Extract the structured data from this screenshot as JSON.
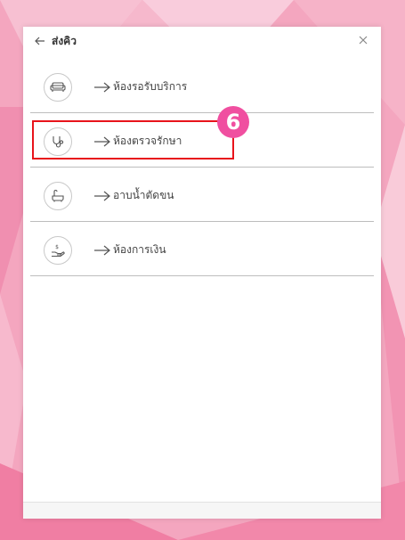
{
  "colors": {
    "background": "#f4a6bf",
    "highlight": "#e8141b",
    "badge": "#f04fa0"
  },
  "header": {
    "back_icon": "arrow-left-icon",
    "title": "ส่งคิว",
    "close_icon": "close-icon"
  },
  "list": {
    "items": [
      {
        "icon": "sofa-icon",
        "label": "ห้องรอรับบริการ"
      },
      {
        "icon": "stethoscope-icon",
        "label": "ห้องตรวจรักษา"
      },
      {
        "icon": "bathtub-icon",
        "label": "อาบน้ำตัดขน"
      },
      {
        "icon": "money-hand-icon",
        "label": "ห้องการเงิน"
      }
    ]
  },
  "annotation": {
    "step_number": "6",
    "highlighted_item": "ห้องตรวจรักษา"
  }
}
